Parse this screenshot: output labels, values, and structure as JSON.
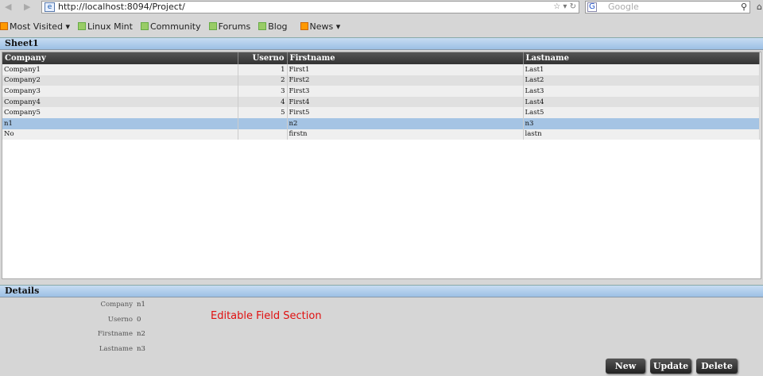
{
  "browser": {
    "url": "http://localhost:8094/Project/",
    "search_placeholder": "Google",
    "bookmarks": [
      {
        "label": "Most Visited ▾"
      },
      {
        "label": "Linux Mint"
      },
      {
        "label": "Community"
      },
      {
        "label": "Forums"
      },
      {
        "label": "Blog"
      },
      {
        "label": "News ▾"
      }
    ]
  },
  "sheet": {
    "title": "Sheet1",
    "columns": [
      "Company",
      "Userno",
      "Firstname",
      "Lastname"
    ],
    "rows": [
      [
        "Company1",
        "1",
        "First1",
        "Last1"
      ],
      [
        "Company2",
        "2",
        "First2",
        "Last2"
      ],
      [
        "Company3",
        "3",
        "First3",
        "Last3"
      ],
      [
        "Company4",
        "4",
        "First4",
        "Last4"
      ],
      [
        "Company5",
        "5",
        "First5",
        "Last5"
      ],
      [
        "n1",
        "",
        "n2",
        "n3"
      ],
      [
        "No",
        "",
        "firstn",
        "lastn"
      ]
    ]
  },
  "details": {
    "title": "Details",
    "fields": [
      {
        "label": "Company",
        "value": "n1"
      },
      {
        "label": "Userno",
        "value": "0"
      },
      {
        "label": "Firstname",
        "value": "n2"
      },
      {
        "label": "Lastname",
        "value": "n3"
      }
    ],
    "note": "Editable Field Section",
    "buttons": {
      "new": "New",
      "update": "Update",
      "delete": "Delete"
    }
  }
}
